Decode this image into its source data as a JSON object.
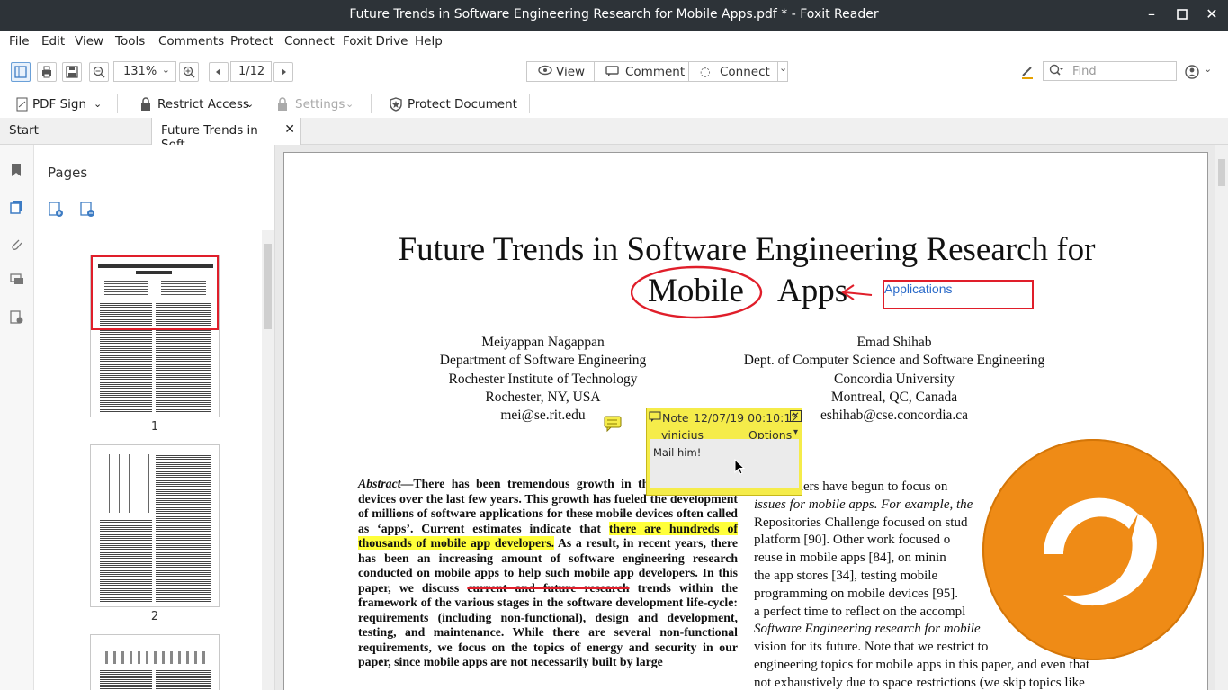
{
  "window": {
    "title": "Future Trends in Software Engineering Research for Mobile Apps.pdf * - Foxit Reader"
  },
  "menu": [
    "File",
    "Edit",
    "View",
    "Tools",
    "Comments",
    "Protect",
    "Connect",
    "Foxit Drive",
    "Help"
  ],
  "toolbar": {
    "zoom": "131%",
    "page": "1/12",
    "view_label": "View",
    "comment_label": "Comment",
    "connect_label": "Connect",
    "find_placeholder": "Find"
  },
  "ribbon": {
    "pdf_sign": "PDF Sign",
    "restrict_access": "Restrict Access",
    "settings": "Settings",
    "protect_document": "Protect Document"
  },
  "tabs": [
    {
      "label": "Start"
    },
    {
      "label": "Future Trends in Soft..."
    }
  ],
  "panel": {
    "title": "Pages",
    "thumb_labels": [
      "1",
      "2"
    ]
  },
  "document": {
    "title_line1": "Future Trends in Software Engineering Research for",
    "title_mobile": "Mobile",
    "title_apps": "Apps",
    "annotation_text": "Applications",
    "author1": [
      "Meiyappan Nagappan",
      "Department of Software Engineering",
      "Rochester Institute of Technology",
      "Rochester, NY, USA",
      "mei@se.rit.edu"
    ],
    "author2": [
      "Emad Shihab",
      "Dept. of Computer Science and Software Engineering",
      "Concordia University",
      "Montreal, QC, Canada",
      "eshihab@cse.concordia.ca"
    ],
    "abstract_label": "Abstract",
    "abstract_1": "—There has been tremendous growth in the use of mobile devices over the last few years. This growth has fueled the development of millions of software applications for these mobile devices often called as ‘apps’. Current estimates indicate that ",
    "abstract_highlight": "there are hundreds of thousands of mobile app developers.",
    "abstract_2": " As a result, in recent years, there has been an increasing amount of software engineering research conducted on mobile apps to help such mobile app developers. In this paper, we discuss ",
    "abstract_strike": "current and future research",
    "abstract_3": " trends within the framework of the various stages in the software development life-cycle: requirements (including non-functional), design and development, testing, and maintenance. While there are several non-functional requirements, we focus on the topics of energy and security in our paper, since mobile apps are not necessarily built by large",
    "right_col": [
      "Researchers have begun to focus on",
      "issues for mobile apps. For example, the",
      "Repositories Challenge focused on stud",
      "platform [90]. Other work focused o",
      "reuse in mobile apps [84], on minin",
      "the app stores [34], testing mobile",
      "programming on mobile devices [95].",
      "a perfect time to reflect on the accompl",
      "Software Engineering research for mobile",
      "vision for its future. Note that we restrict to",
      "engineering topics for mobile apps in this paper, and even that",
      "not exhaustively due to space restrictions (we skip topics like"
    ]
  },
  "note": {
    "title": "Note",
    "date": "12/07/19 00:10:12",
    "author": "vinicius",
    "options": "Options",
    "body": "Mail him!"
  },
  "colors": {
    "titlebar": "#2d3338",
    "highlight": "#ffff3a",
    "ink_red": "#e01e2a",
    "note_yellow": "#f5ec4a",
    "foxit_orange": "#ef8b16",
    "link_blue": "#2a6ac9"
  }
}
